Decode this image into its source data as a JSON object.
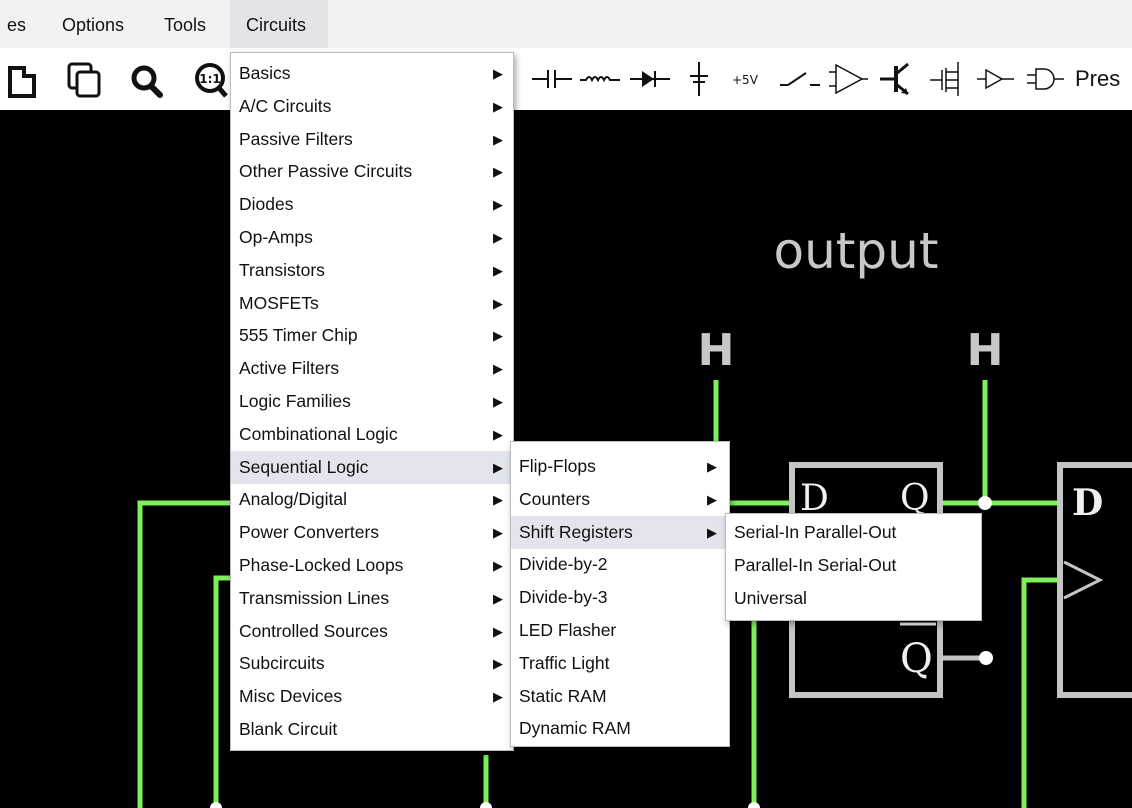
{
  "menubar": {
    "items": [
      {
        "label": "es"
      },
      {
        "label": "Options"
      },
      {
        "label": "Tools"
      },
      {
        "label": "Circuits"
      }
    ]
  },
  "toolbar": {
    "icons": [
      "paste-icon",
      "duplicate-icon",
      "zoom-icon",
      "zoom-100-icon",
      "capacitor-icon",
      "inductor-icon",
      "diode-icon",
      "ground-icon",
      "voltage-rail-icon",
      "switch-icon",
      "opamp-icon",
      "transistor-icon",
      "mosfet-icon",
      "buffer-icon",
      "and-gate-icon"
    ],
    "zoom_label": "1:1",
    "rail_label": "+5V",
    "cut_text": "Pres"
  },
  "canvas": {
    "output_label": "output",
    "h_labels": [
      "H",
      "H"
    ],
    "ff1": {
      "d": "D",
      "q": "Q",
      "qbar": "Q"
    },
    "ff2": {
      "d": "D"
    },
    "colors": {
      "wire": "#7df05a",
      "chip": "#c4c4c4",
      "text": "#c8c8c8"
    }
  },
  "menus": {
    "main": [
      {
        "label": "Basics",
        "submenu": true
      },
      {
        "label": "A/C Circuits",
        "submenu": true
      },
      {
        "label": "Passive Filters",
        "submenu": true
      },
      {
        "label": "Other Passive Circuits",
        "submenu": true
      },
      {
        "label": "Diodes",
        "submenu": true
      },
      {
        "label": "Op-Amps",
        "submenu": true
      },
      {
        "label": "Transistors",
        "submenu": true
      },
      {
        "label": "MOSFETs",
        "submenu": true
      },
      {
        "label": "555 Timer Chip",
        "submenu": true
      },
      {
        "label": "Active Filters",
        "submenu": true
      },
      {
        "label": "Logic Families",
        "submenu": true
      },
      {
        "label": "Combinational Logic",
        "submenu": true
      },
      {
        "label": "Sequential Logic",
        "submenu": true,
        "highlighted": true
      },
      {
        "label": "Analog/Digital",
        "submenu": true
      },
      {
        "label": "Power Converters",
        "submenu": true
      },
      {
        "label": "Phase-Locked Loops",
        "submenu": true
      },
      {
        "label": "Transmission Lines",
        "submenu": true
      },
      {
        "label": "Controlled Sources",
        "submenu": true
      },
      {
        "label": "Subcircuits",
        "submenu": true
      },
      {
        "label": "Misc Devices",
        "submenu": true
      },
      {
        "label": "Blank Circuit",
        "submenu": false
      }
    ],
    "sequential": [
      {
        "label": "Flip-Flops",
        "submenu": true
      },
      {
        "label": "Counters",
        "submenu": true
      },
      {
        "label": "Shift Registers",
        "submenu": true,
        "highlighted": true
      },
      {
        "label": "Divide-by-2",
        "submenu": false
      },
      {
        "label": "Divide-by-3",
        "submenu": false
      },
      {
        "label": "LED Flasher",
        "submenu": false
      },
      {
        "label": "Traffic Light",
        "submenu": false
      },
      {
        "label": "Static RAM",
        "submenu": false
      },
      {
        "label": "Dynamic RAM",
        "submenu": false
      }
    ],
    "shift_registers": [
      {
        "label": "Serial-In Parallel-Out",
        "submenu": false
      },
      {
        "label": "Parallel-In Serial-Out",
        "submenu": false
      },
      {
        "label": "Universal",
        "submenu": false
      }
    ]
  }
}
